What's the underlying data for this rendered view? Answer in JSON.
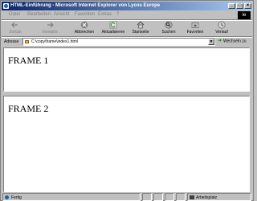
{
  "window": {
    "title": "HTML-Einführung - Microsoft Internet Explorer von Lycos Europe",
    "controls": [
      "_",
      "□",
      "×"
    ]
  },
  "menu": {
    "items": [
      "Datei",
      "Bearbeiten",
      "Ansicht",
      "Favoriten",
      "Extras",
      "?"
    ]
  },
  "brand": {
    "logo_text": "ie"
  },
  "toolbar": {
    "back_label": "Zurück",
    "forward_label": "Vorwärts",
    "stop_label": "Abbrechen",
    "refresh_label": "Aktualisieren",
    "home_label": "Startseite",
    "search_label": "Suchen",
    "favorites_label": "Favoriten",
    "history_label": "Verlauf"
  },
  "address": {
    "label": "Adresse",
    "value": "C:\\copy\\frame\\index1.html",
    "go_label": "Wechseln zu"
  },
  "frames": [
    {
      "text": "FRAME 1"
    },
    {
      "text": "FRAME 2"
    }
  ],
  "status": {
    "left_text": "Fertig",
    "zone_text": "Arbeitsplatz"
  },
  "colors": {
    "titlebar_start": "#0a246a",
    "titlebar_end": "#a6caf0",
    "chrome": "#c0c0c0",
    "frame_bg": "#ffffff"
  }
}
